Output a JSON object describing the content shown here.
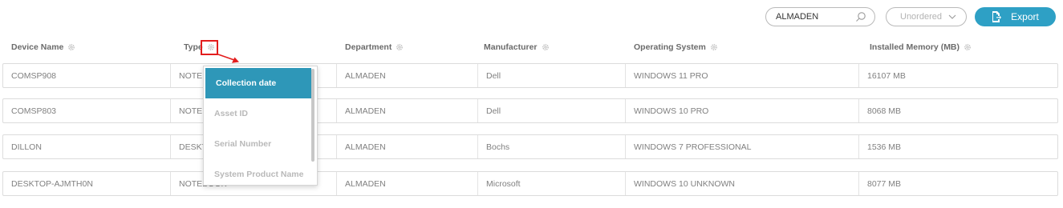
{
  "toolbar": {
    "search": {
      "value": "ALMADEN",
      "icon": "search-icon"
    },
    "sort_select": {
      "selected": "Unordered",
      "icon": "chevron-down-icon"
    },
    "export": {
      "label": "Export",
      "icon": "export-icon"
    }
  },
  "table": {
    "headers": [
      "Device Name",
      "Type",
      "Department",
      "Manufacturer",
      "Operating System",
      "Installed Memory (MB)"
    ],
    "rows": [
      [
        "COMSP908",
        "NOTEI",
        "ALMADEN",
        "Dell",
        "WINDOWS 11 PRO",
        "16107 MB"
      ],
      [
        "COMSP803",
        "NOTEI",
        "ALMADEN",
        "Dell",
        "WINDOWS 10 PRO",
        "8068 MB"
      ],
      [
        "DILLON",
        "DESKT",
        "ALMADEN",
        "Bochs",
        "WINDOWS 7 PROFESSIONAL",
        "1536 MB"
      ],
      [
        "DESKTOP-AJMTH0N",
        "NOTEBOOK",
        "ALMADEN",
        "Microsoft",
        "WINDOWS 10 UNKNOWN",
        "8077 MB"
      ]
    ]
  },
  "column_menu": {
    "items": [
      "Collection date",
      "Asset ID",
      "Serial Number",
      "System Product Name"
    ],
    "active_index": 0
  },
  "colors": {
    "accent": "#2ea0c5",
    "menu_active": "#2e97b8",
    "highlight": "#e31d1d"
  }
}
